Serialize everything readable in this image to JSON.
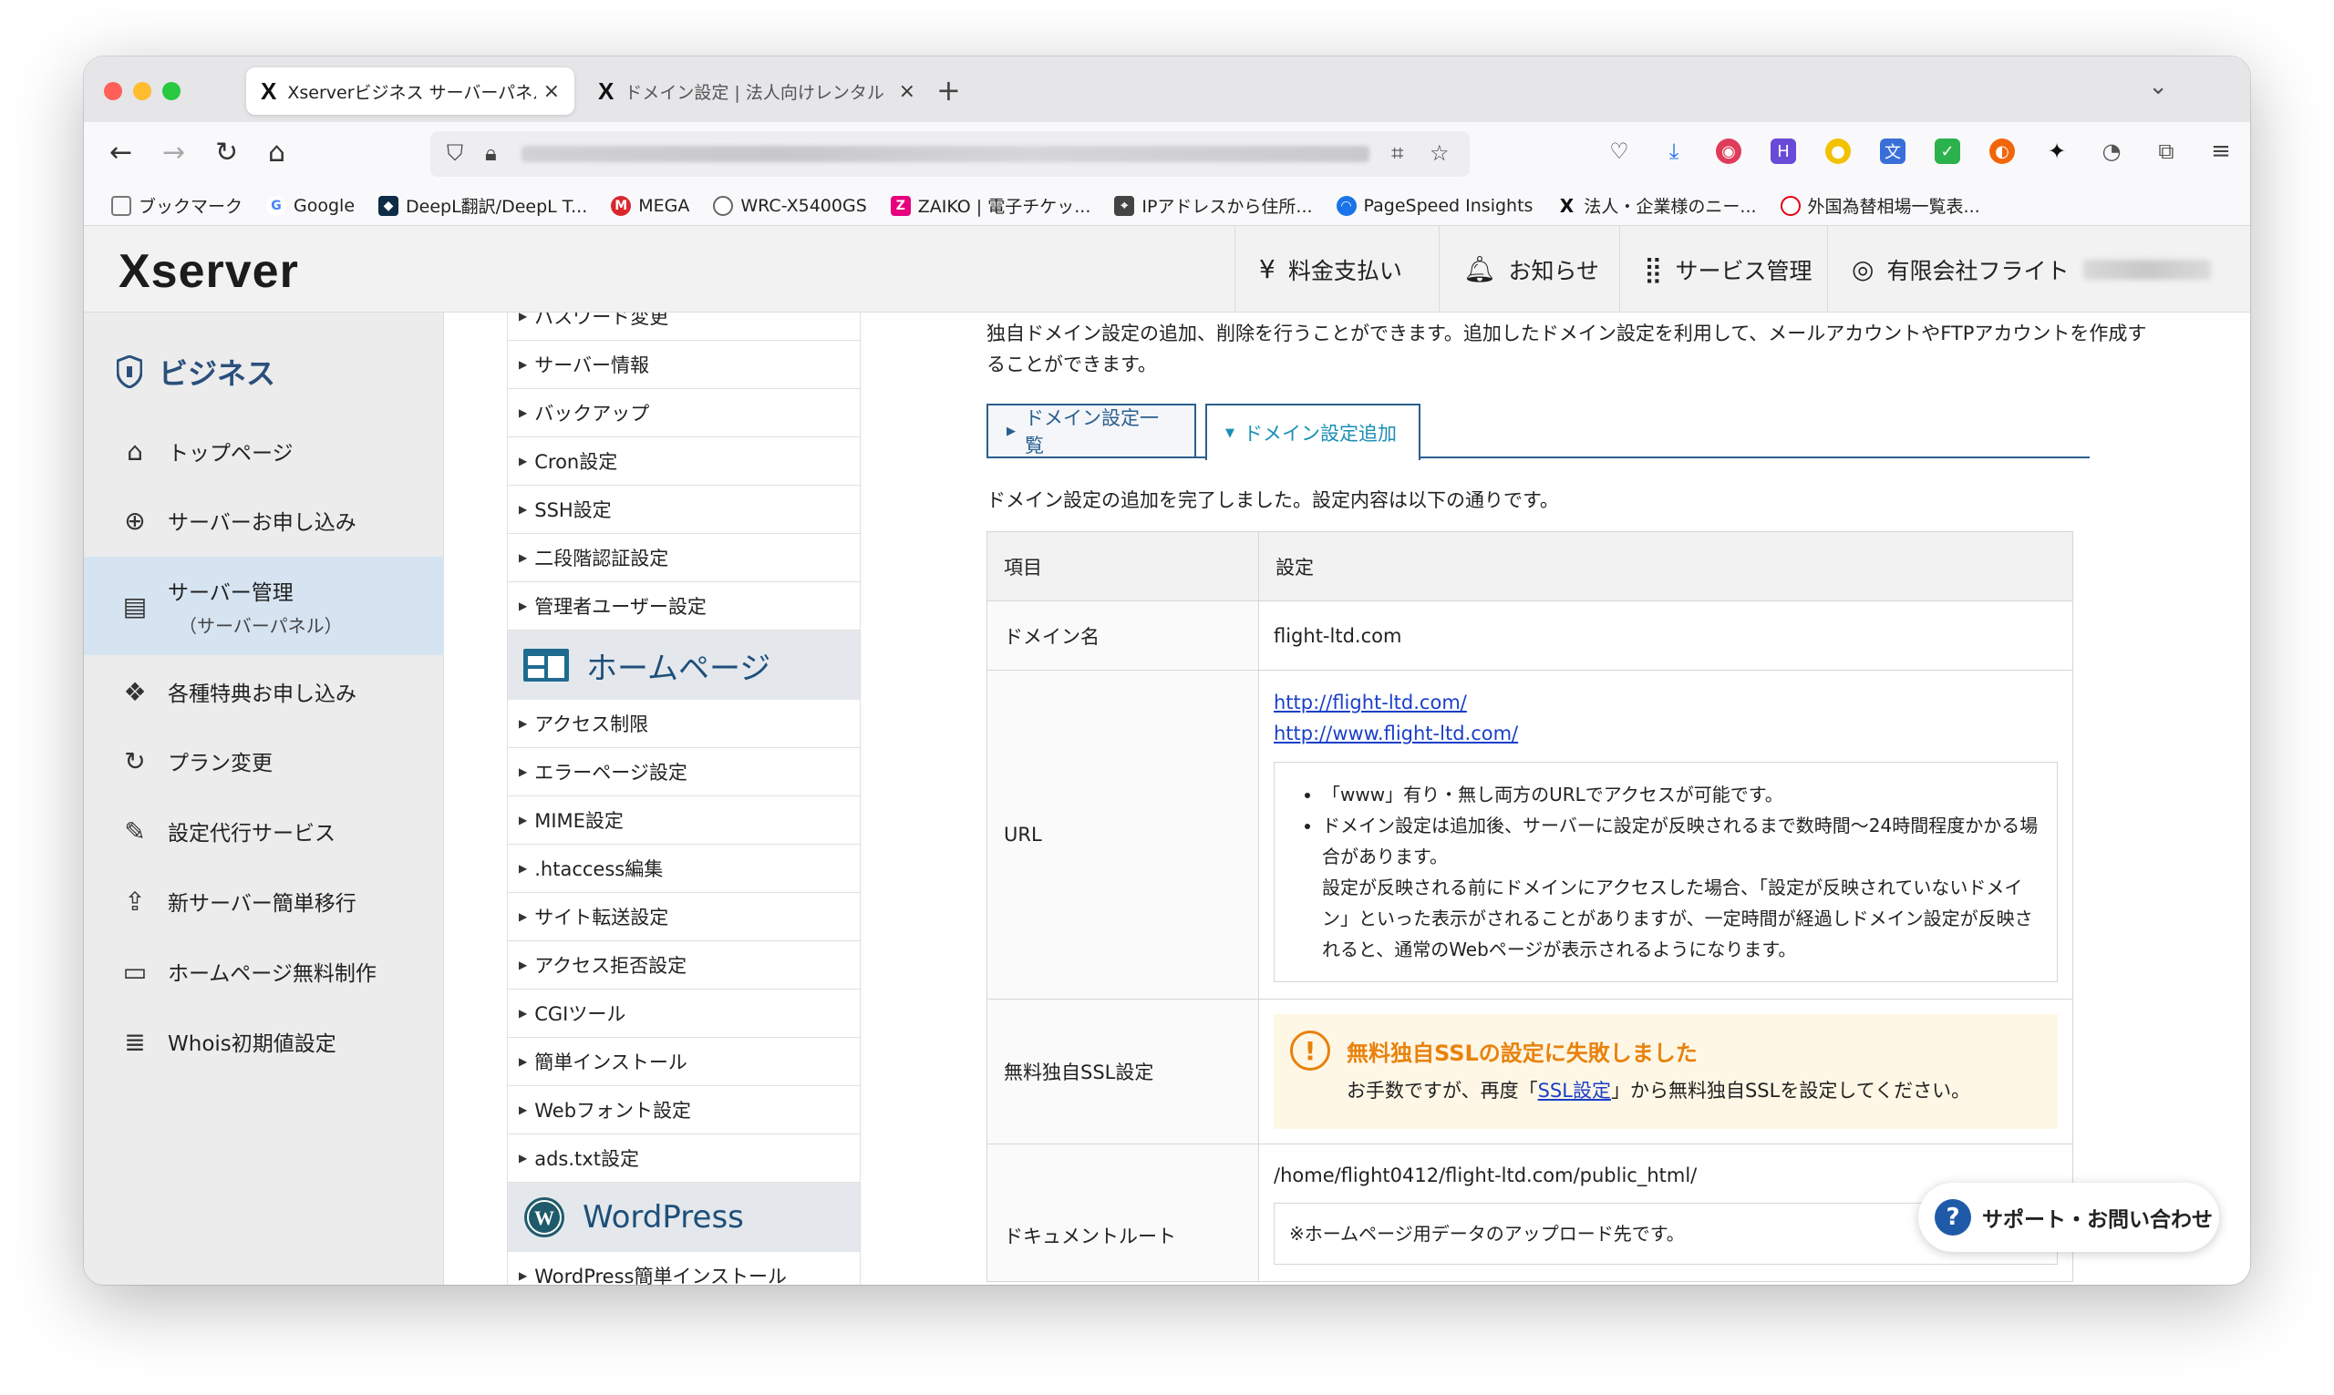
{
  "browser": {
    "tabs": [
      {
        "label": "Xserverビジネス サーバーパネル",
        "close": "×"
      },
      {
        "label": "ドメイン設定 | 法人向けレンタル",
        "close": "×"
      }
    ],
    "new_tab": "+",
    "tablist": "⌄",
    "bookmarks": [
      {
        "label": "ブックマーク",
        "icon": "folder-icon",
        "color": "#888888"
      },
      {
        "label": "Google",
        "icon": "google-icon",
        "color": "#4285f4"
      },
      {
        "label": "DeepL翻訳/DeepL T...",
        "icon": "deepl-icon",
        "color": "#0f2b46"
      },
      {
        "label": "MEGA",
        "icon": "mega-icon",
        "color": "#d9272e"
      },
      {
        "label": "WRC-X5400GS",
        "icon": "globe-icon",
        "color": "#666666"
      },
      {
        "label": "ZAIKO | 電子チケッ...",
        "icon": "zaiko-icon",
        "color": "#e6007e"
      },
      {
        "label": "IPアドレスから住所...",
        "icon": "ip-icon",
        "color": "#444444"
      },
      {
        "label": "PageSpeed Insights",
        "icon": "pagespeed-icon",
        "color": "#1a73e8"
      },
      {
        "label": "法人・企業様のニー...",
        "icon": "xserver-icon",
        "color": "#111111"
      },
      {
        "label": "外国為替相場一覧表...",
        "icon": "mufg-icon",
        "color": "#e60012"
      }
    ]
  },
  "header": {
    "logo": "Xserver",
    "nav": [
      {
        "label": "料金支払い",
        "icon": "yen-icon"
      },
      {
        "label": "お知らせ",
        "icon": "bell-icon"
      },
      {
        "label": "サービス管理",
        "icon": "grid-icon"
      },
      {
        "label": "有限会社フライト",
        "icon": "user-icon"
      }
    ]
  },
  "sidebar": {
    "title": "ビジネス",
    "items": [
      {
        "label": "トップページ",
        "icon": "home-icon",
        "glyph": "⌂"
      },
      {
        "label": "サーバーお申し込み",
        "icon": "plus-circle-icon",
        "glyph": "⊕"
      },
      {
        "label": "サーバー管理",
        "sub": "（サーバーパネル）",
        "icon": "server-icon",
        "glyph": "▤"
      },
      {
        "label": "各種特典お申し込み",
        "icon": "gift-icon",
        "glyph": "❖"
      },
      {
        "label": "プラン変更",
        "icon": "refresh-icon",
        "glyph": "↻"
      },
      {
        "label": "設定代行サービス",
        "icon": "wrench-icon",
        "glyph": "✎"
      },
      {
        "label": "新サーバー簡単移行",
        "icon": "upload-icon",
        "glyph": "⇪"
      },
      {
        "label": "ホームページ無料制作",
        "icon": "window-icon",
        "glyph": "▭"
      },
      {
        "label": "Whois初期値設定",
        "icon": "document-icon",
        "glyph": "≣"
      }
    ]
  },
  "menu": {
    "group1": [
      "パスワード変更",
      "サーバー情報",
      "バックアップ",
      "Cron設定",
      "SSH設定",
      "二段階認証設定",
      "管理者ユーザー設定"
    ],
    "homepage_title": "ホームページ",
    "group2": [
      "アクセス制限",
      "エラーページ設定",
      "MIME設定",
      ".htaccess編集",
      "サイト転送設定",
      "アクセス拒否設定",
      "CGIツール",
      "簡単インストール",
      "Webフォント設定",
      "ads.txt設定"
    ],
    "wordpress_title": "WordPress",
    "group3": [
      "WordPress簡単インストール"
    ]
  },
  "content": {
    "description": "独自ドメイン設定の追加、削除を行うことができます。追加したドメイン設定を利用して、メールアカウントやFTPアカウントを作成することができます。",
    "tabs": [
      "ドメイン設定一覧",
      "ドメイン設定追加"
    ],
    "done_message": "ドメイン設定の追加を完了しました。設定内容は以下の通りです。",
    "table": {
      "headers": [
        "項目",
        "設定"
      ],
      "domain_label": "ドメイン名",
      "domain_value": "flight-ltd.com",
      "url_label": "URL",
      "urls": [
        "http://flight-ltd.com/",
        "http://www.flight-ltd.com/"
      ],
      "notes": [
        "「www」有り・無し両方のURLでアクセスが可能です。",
        "ドメイン設定は追加後、サーバーに設定が反映されるまで数時間〜24時間程度かかる場合があります。"
      ],
      "note_extra": "設定が反映される前にドメインにアクセスした場合、「設定が反映されていないドメイン」といった表示がされることがありますが、一定時間が経過しドメイン設定が反映されると、通常のWebページが表示されるようになります。",
      "ssl_label": "無料独自SSL設定",
      "ssl_error_title": "無料独自SSLの設定に失敗しました",
      "ssl_error_pre": "お手数ですが、再度「",
      "ssl_error_link": "SSL設定",
      "ssl_error_post": "」から無料独自SSLを設定してください。",
      "docroot_label": "ドキュメントルート",
      "docroot_value": "/home/flight0412/flight-ltd.com/public_html/",
      "docroot_note": "※ホームページ用データのアップロード先です。"
    }
  },
  "support": {
    "label": "サポート・お問い合わせ",
    "icon": "help-icon"
  },
  "colors": {
    "accent": "#2a5f8f",
    "error": "#e8820c",
    "link": "#1a3fc9",
    "sidebar_active": "#d6e4f2"
  }
}
